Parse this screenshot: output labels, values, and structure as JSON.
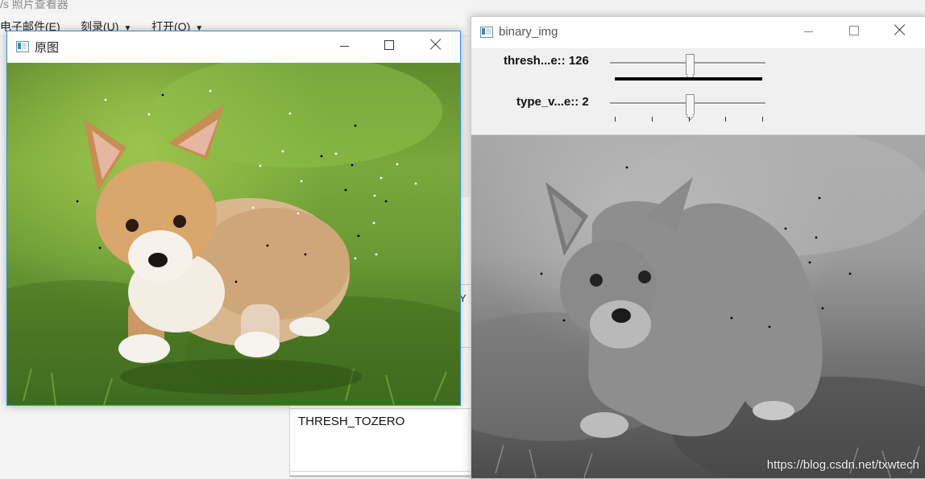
{
  "background_app": {
    "title": "/s 照片查看器",
    "menu": [
      {
        "label": "电子邮件(E)",
        "has_caret": false
      },
      {
        "label": "刻录(U)",
        "has_caret": true
      },
      {
        "label": "打开(O)",
        "has_caret": true
      }
    ],
    "table_cell_text": "THRESH_TOZERO",
    "cut_char": "Y"
  },
  "window_original": {
    "title": "原图",
    "icon": "app-window-icon"
  },
  "window_binary": {
    "title": "binary_img",
    "icon": "app-window-icon",
    "trackbars": [
      {
        "label": "thresh...e:: 126",
        "value": 126,
        "max": 255,
        "fill_fraction": 0.5
      },
      {
        "label": "type_v...e:: 2",
        "value": 2,
        "max": 4,
        "tick_count": 5
      }
    ],
    "watermark": "https://blog.csdn.net/txwtech"
  },
  "colors": {
    "active_window_border": "#3d8bd4",
    "trackbar_fill": "#000000",
    "grass": "#6b9a35",
    "puppy_fur": "#d9b48a"
  }
}
